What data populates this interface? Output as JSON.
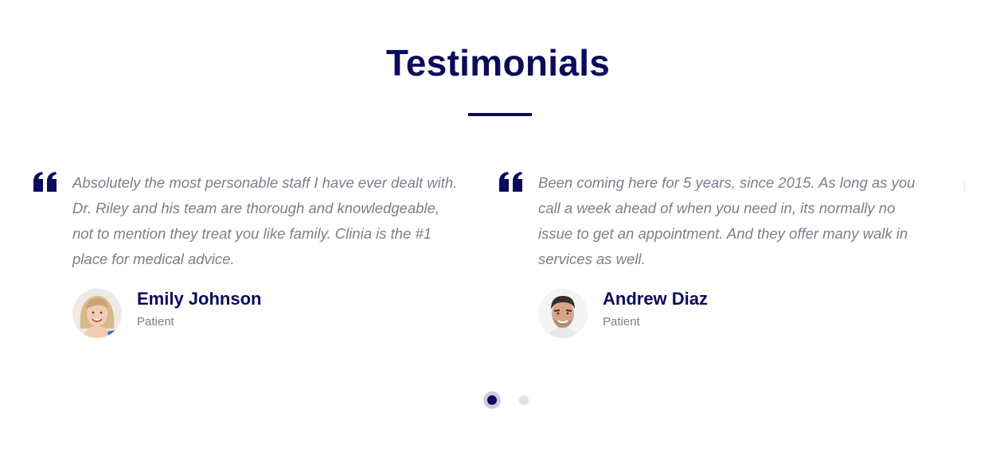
{
  "section": {
    "title": "Testimonials"
  },
  "testimonials": [
    {
      "quote": "Absolutely the most personable staff I have ever dealt with. Dr. Riley and his team are thorough and knowledgeable, not to mention they treat you like family. Clinia is the #1 place for medical advice.",
      "name": "Emily Johnson",
      "role": "Patient",
      "avatar_icon": "woman-portrait"
    },
    {
      "quote": "Been coming here for 5 years, since 2015. As long as you call a week ahead of when you need in, its normally no issue to get an appointment. And they offer many walk in services as well.",
      "name": "Andrew Diaz",
      "role": "Patient",
      "avatar_icon": "man-portrait"
    }
  ],
  "pagination": {
    "total": 2,
    "active_index": 0
  },
  "colors": {
    "primary": "#0c0a5c",
    "text_muted": "#7a7f8a",
    "dot_inactive": "#e1e1e6",
    "dot_active_ring": "#cbcbe0"
  }
}
